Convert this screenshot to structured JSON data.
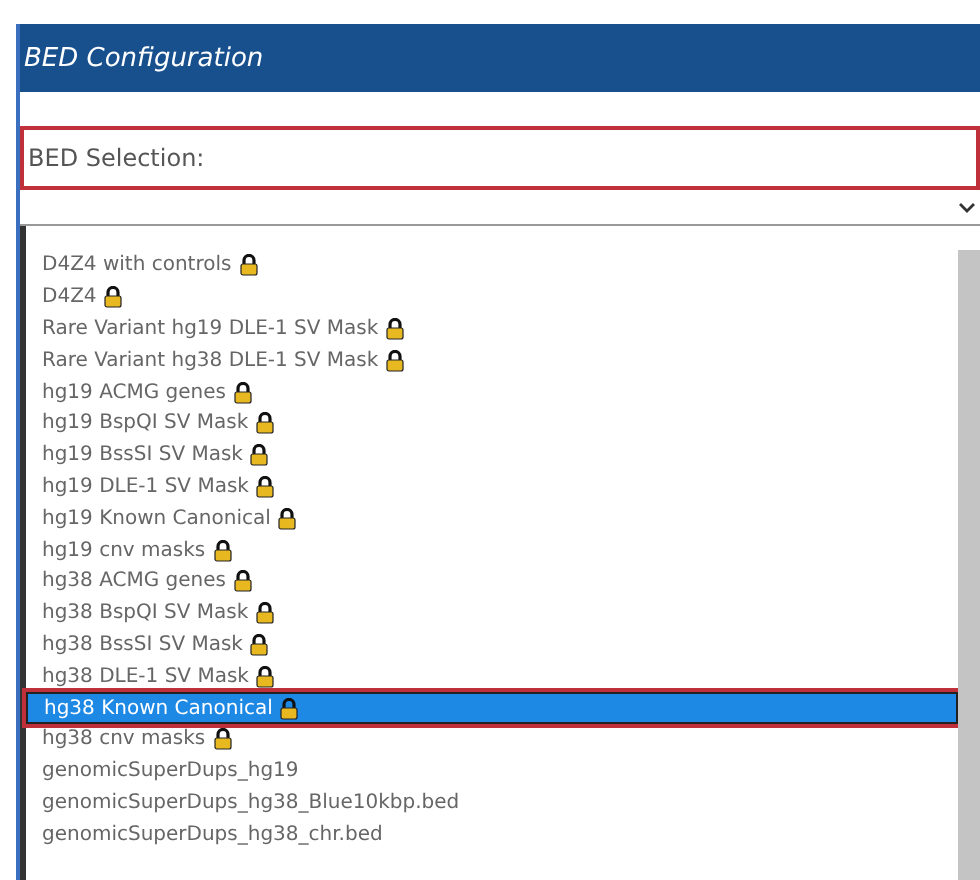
{
  "window": {
    "title": "BED Configuration"
  },
  "selection": {
    "label": "BED Selection:"
  },
  "options": [
    {
      "label": "D4Z4 with controls",
      "locked": true,
      "selected": false
    },
    {
      "label": "D4Z4",
      "locked": true,
      "selected": false
    },
    {
      "label": "Rare Variant hg19 DLE-1 SV Mask",
      "locked": true,
      "selected": false
    },
    {
      "label": "Rare Variant hg38 DLE-1 SV Mask",
      "locked": true,
      "selected": false
    },
    {
      "label": "hg19 ACMG genes",
      "locked": true,
      "selected": false
    },
    {
      "label": "hg19 BspQI SV Mask",
      "locked": true,
      "selected": false
    },
    {
      "label": "hg19 BssSI SV Mask",
      "locked": true,
      "selected": false
    },
    {
      "label": "hg19 DLE-1 SV Mask",
      "locked": true,
      "selected": false
    },
    {
      "label": "hg19 Known Canonical",
      "locked": true,
      "selected": false
    },
    {
      "label": "hg19 cnv masks",
      "locked": true,
      "selected": false
    },
    {
      "label": "hg38 ACMG genes",
      "locked": true,
      "selected": false
    },
    {
      "label": "hg38 BspQI SV Mask",
      "locked": true,
      "selected": false
    },
    {
      "label": "hg38 BssSI SV Mask",
      "locked": true,
      "selected": false
    },
    {
      "label": "hg38 DLE-1 SV Mask",
      "locked": true,
      "selected": false
    },
    {
      "label": "hg38 Known Canonical",
      "locked": true,
      "selected": true
    },
    {
      "label": "hg38 cnv masks",
      "locked": true,
      "selected": false
    },
    {
      "label": "genomicSuperDups_hg19",
      "locked": false,
      "selected": false
    },
    {
      "label": "genomicSuperDups_hg38_Blue10kbp.bed",
      "locked": false,
      "selected": false
    },
    {
      "label": "genomicSuperDups_hg38_chr.bed",
      "locked": false,
      "selected": false
    }
  ]
}
